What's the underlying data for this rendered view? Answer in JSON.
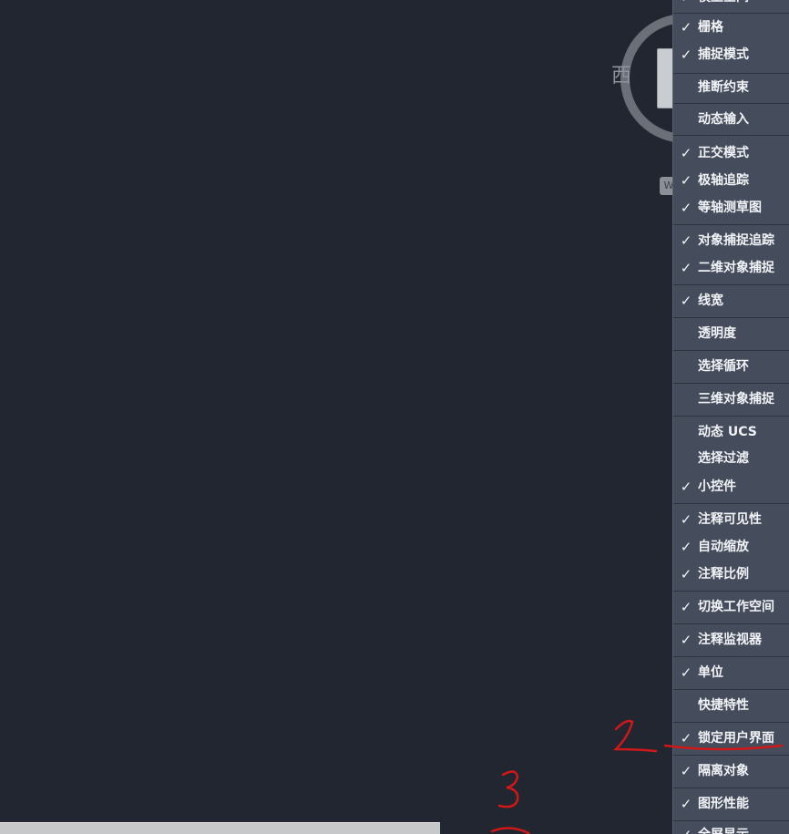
{
  "viewcube": {
    "west_label": "西",
    "wcs_label": "W"
  },
  "menu": {
    "items": [
      {
        "label": "模型空间",
        "checked": true
      },
      {
        "label": "栅格",
        "checked": true
      },
      {
        "label": "捕捉模式",
        "checked": true
      },
      {
        "label": "推断约束",
        "checked": false
      },
      {
        "label": "动态输入",
        "checked": false
      },
      {
        "label": "正交模式",
        "checked": true
      },
      {
        "label": "极轴追踪",
        "checked": true
      },
      {
        "label": "等轴测草图",
        "checked": true
      },
      {
        "label": "对象捕捉追踪",
        "checked": true
      },
      {
        "label": "二维对象捕捉",
        "checked": true
      },
      {
        "label": "线宽",
        "checked": true
      },
      {
        "label": "透明度",
        "checked": false
      },
      {
        "label": "选择循环",
        "checked": false
      },
      {
        "label": "三维对象捕捉",
        "checked": false
      },
      {
        "label": "动态 UCS",
        "checked": false
      },
      {
        "label": "选择过滤",
        "checked": false
      },
      {
        "label": "小控件",
        "checked": true
      },
      {
        "label": "注释可见性",
        "checked": true
      },
      {
        "label": "自动缩放",
        "checked": true
      },
      {
        "label": "注释比例",
        "checked": true
      },
      {
        "label": "切换工作空间",
        "checked": true
      },
      {
        "label": "注释监视器",
        "checked": true
      },
      {
        "label": "单位",
        "checked": true
      },
      {
        "label": "快捷特性",
        "checked": false
      },
      {
        "label": "锁定用户界面",
        "checked": true
      },
      {
        "label": "隔离对象",
        "checked": true
      },
      {
        "label": "图形性能",
        "checked": true
      },
      {
        "label": "全屏显示",
        "checked": true
      }
    ],
    "check_glyph": "✓"
  },
  "annotations": {
    "color": "#d01818"
  }
}
